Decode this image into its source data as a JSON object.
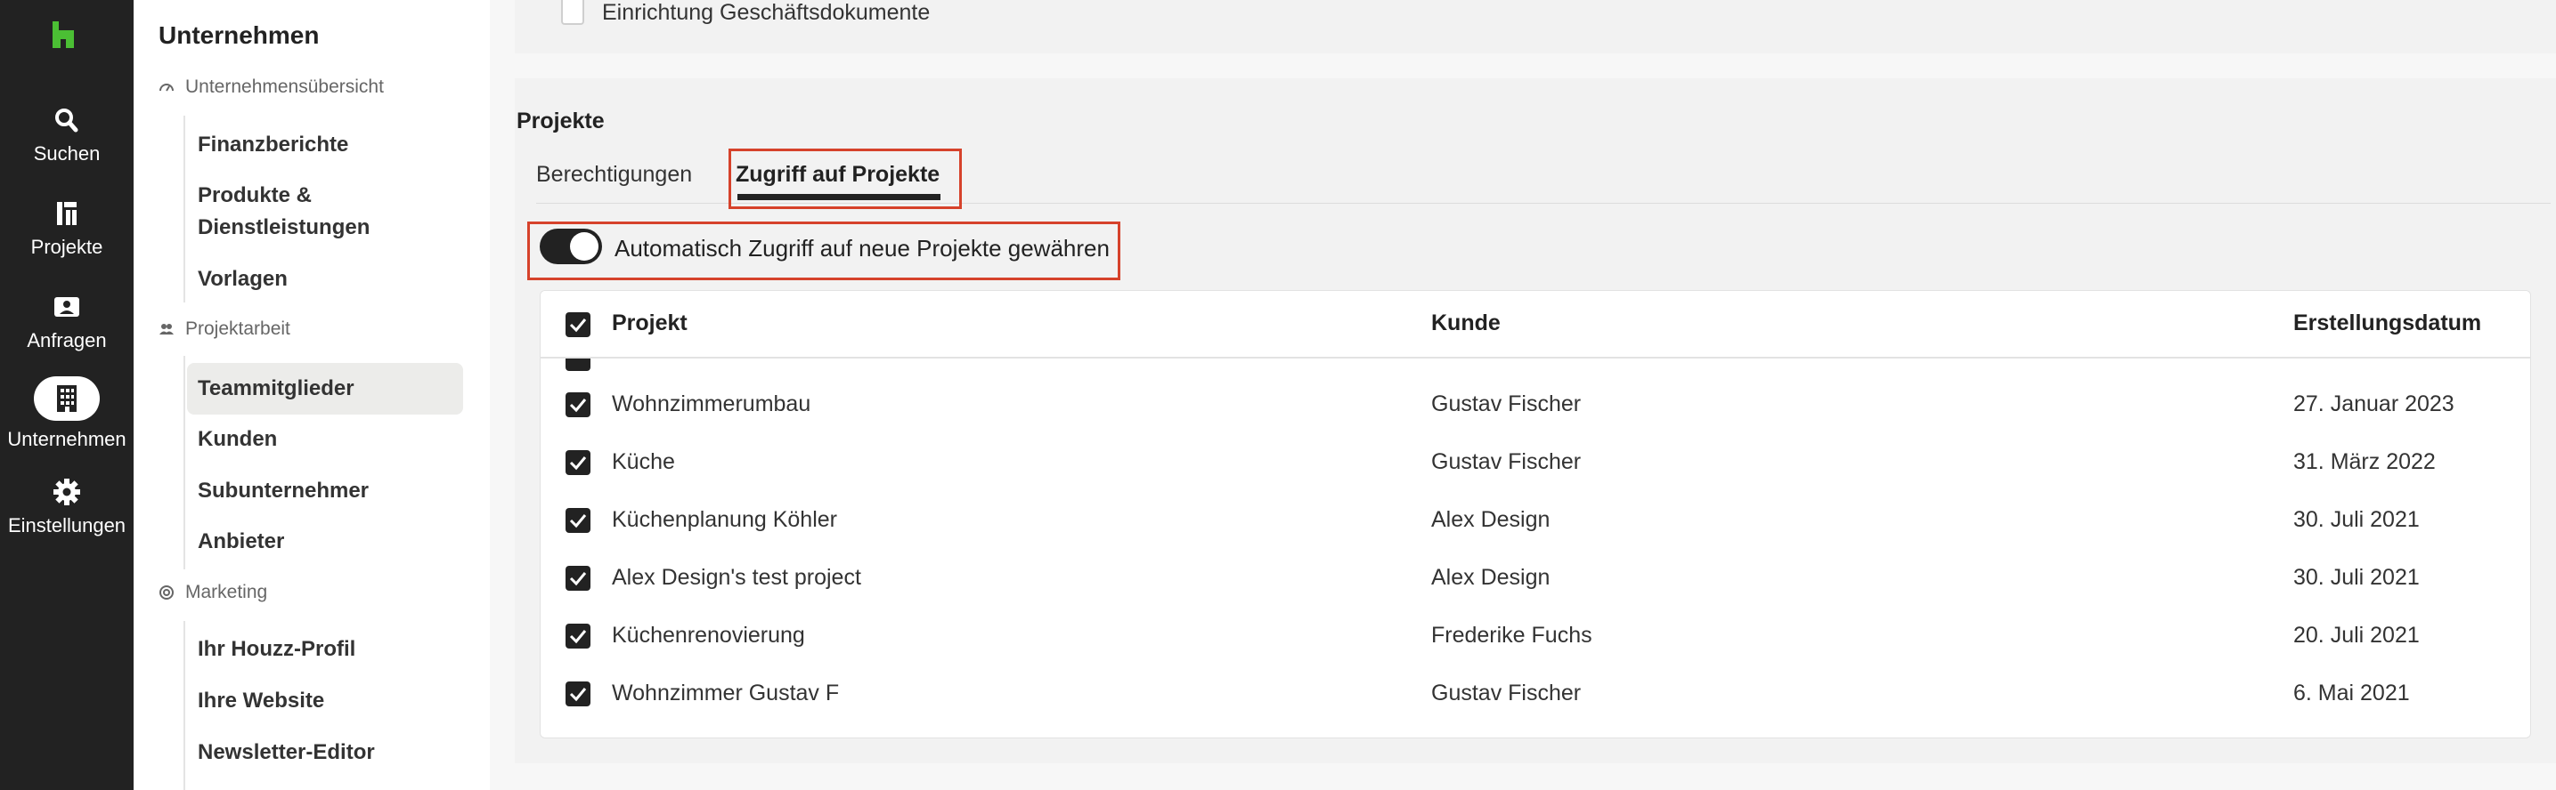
{
  "rail": {
    "items": [
      {
        "label": "Suchen",
        "icon": "search-icon"
      },
      {
        "label": "Projekte",
        "icon": "projects-icon"
      },
      {
        "label": "Anfragen",
        "icon": "inbox-icon"
      },
      {
        "label": "Unternehmen",
        "icon": "building-icon",
        "active": true
      },
      {
        "label": "Einstellungen",
        "icon": "gear-icon"
      }
    ]
  },
  "nav": {
    "title": "Unternehmen",
    "sections": [
      {
        "label": "Unternehmensübersicht",
        "items": [
          "Finanzberichte",
          "Produkte &",
          "Dienstleistungen",
          "Vorlagen"
        ]
      },
      {
        "label": "Projektarbeit",
        "items": [
          "Teammitglieder",
          "Kunden",
          "Subunternehmer",
          "Anbieter"
        ]
      },
      {
        "label": "Marketing",
        "items": [
          "Ihr Houzz-Profil",
          "Ihre Website",
          "Newsletter-Editor"
        ]
      }
    ]
  },
  "top_card": {
    "label": "Einrichtung Geschäftsdokumente"
  },
  "projects": {
    "title": "Projekte",
    "tabs": [
      "Berechtigungen",
      "Zugriff auf Projekte"
    ],
    "toggle_label": "Automatisch Zugriff auf neue Projekte gewähren",
    "columns": [
      "Projekt",
      "Kunde",
      "Erstellungsdatum"
    ],
    "rows": [
      {
        "project": "Wohnzimmerumbau",
        "client": "Gustav Fischer",
        "date": "27. Januar 2023"
      },
      {
        "project": "Küche",
        "client": "Gustav Fischer",
        "date": "31. März 2022"
      },
      {
        "project": "Küchenplanung Köhler",
        "client": "Alex Design",
        "date": "30. Juli 2021"
      },
      {
        "project": "Alex Design's test project",
        "client": "Alex Design",
        "date": "30. Juli 2021"
      },
      {
        "project": "Küchenrenovierung",
        "client": "Frederike Fuchs",
        "date": "20. Juli 2021"
      },
      {
        "project": "Wohnzimmer Gustav F",
        "client": "Gustav Fischer",
        "date": "6. Mai 2021"
      }
    ]
  },
  "colors": {
    "brand": "#4bbf34",
    "highlight": "#d6422b",
    "rail": "#222222"
  }
}
